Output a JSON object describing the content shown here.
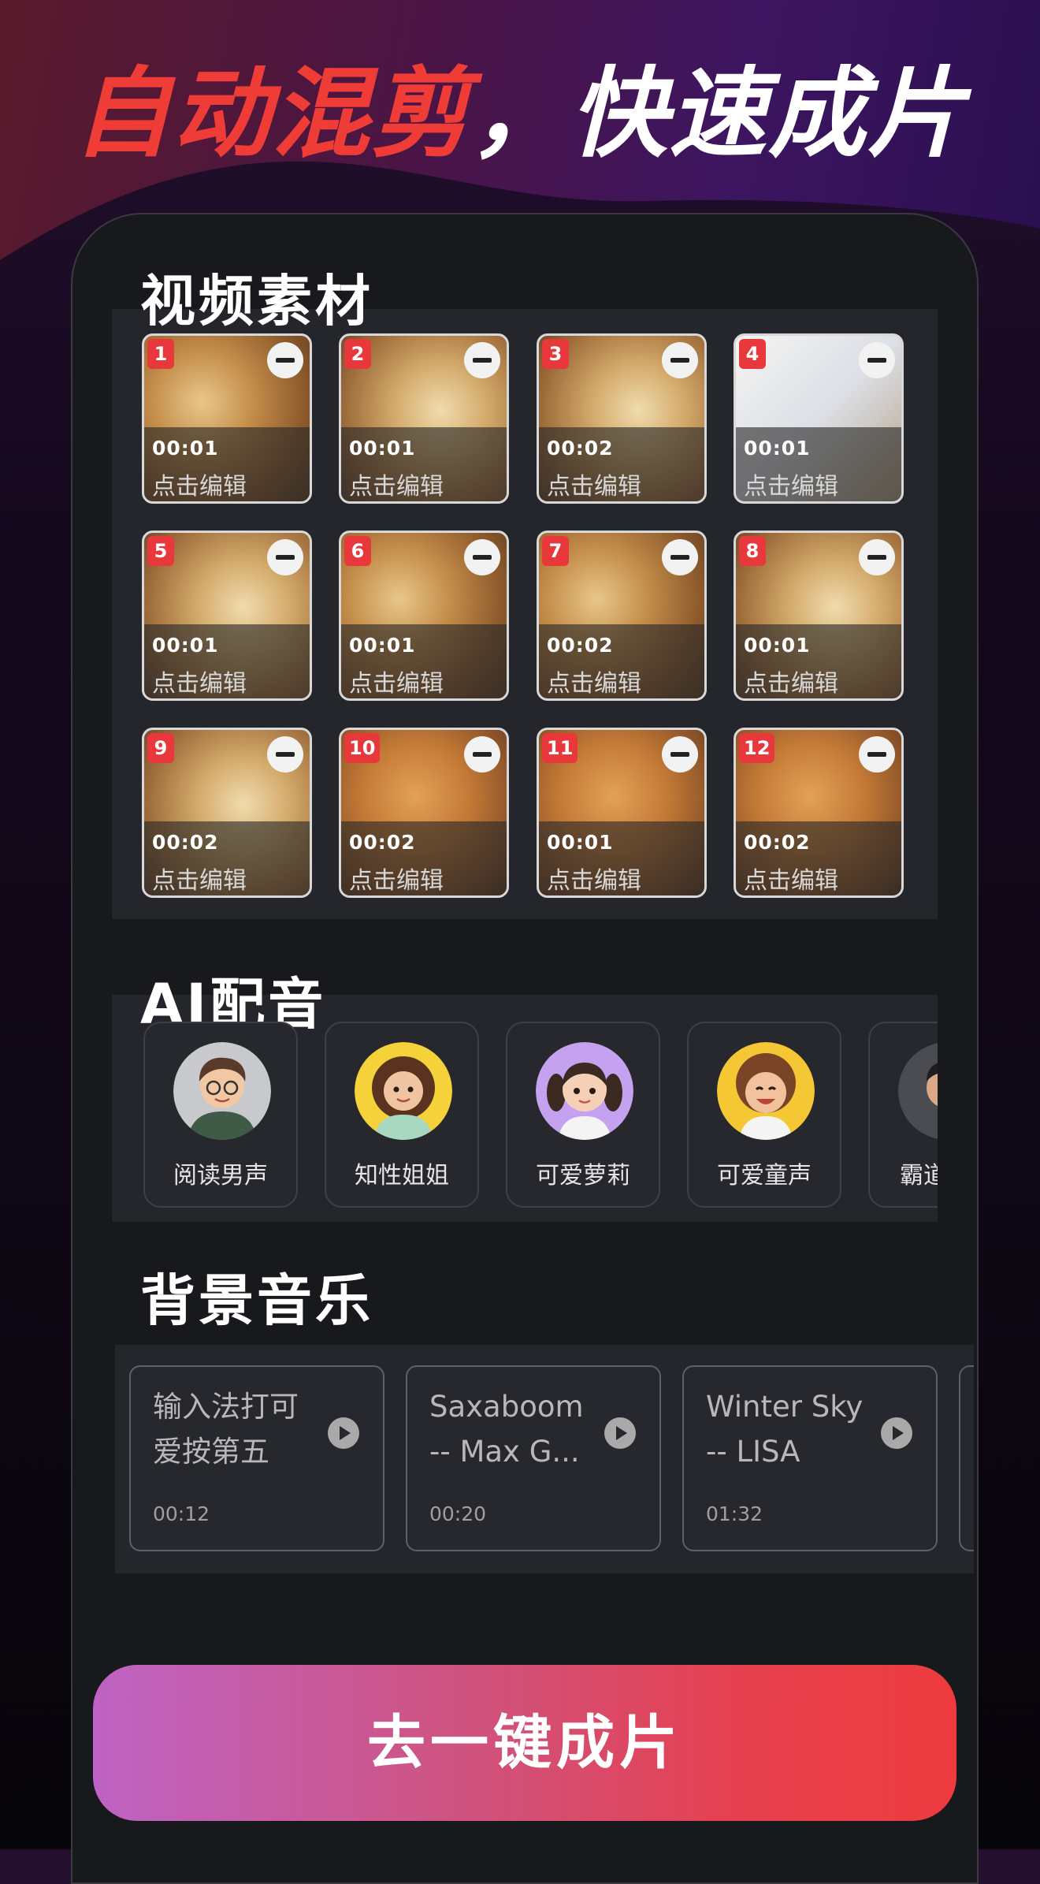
{
  "headline": {
    "highlight": "自动混剪",
    "rest": "，快速成片"
  },
  "sections": {
    "video": "视频素材",
    "voice": "AI配音",
    "music": "背景音乐"
  },
  "clips": [
    {
      "num": "1",
      "duration": "00:01",
      "action": "点击编辑"
    },
    {
      "num": "2",
      "duration": "00:01",
      "action": "点击编辑"
    },
    {
      "num": "3",
      "duration": "00:02",
      "action": "点击编辑"
    },
    {
      "num": "4",
      "duration": "00:01",
      "action": "点击编辑"
    },
    {
      "num": "5",
      "duration": "00:01",
      "action": "点击编辑"
    },
    {
      "num": "6",
      "duration": "00:01",
      "action": "点击编辑"
    },
    {
      "num": "7",
      "duration": "00:02",
      "action": "点击编辑"
    },
    {
      "num": "8",
      "duration": "00:01",
      "action": "点击编辑"
    },
    {
      "num": "9",
      "duration": "00:02",
      "action": "点击编辑"
    },
    {
      "num": "10",
      "duration": "00:02",
      "action": "点击编辑"
    },
    {
      "num": "11",
      "duration": "00:01",
      "action": "点击编辑"
    },
    {
      "num": "12",
      "duration": "00:02",
      "action": "点击编辑"
    }
  ],
  "voices": [
    {
      "name": "阅读男声",
      "icon": "avatar-glasses-man"
    },
    {
      "name": "知性姐姐",
      "icon": "avatar-curly-woman"
    },
    {
      "name": "可爱萝莉",
      "icon": "avatar-pigtail-girl"
    },
    {
      "name": "可爱童声",
      "icon": "avatar-curly-child"
    },
    {
      "name": "霸道",
      "icon": "avatar-man"
    }
  ],
  "music": [
    {
      "title": "输入法打可\n爱按第五",
      "duration": "00:12"
    },
    {
      "title": "Saxaboom\n-- Max G...",
      "duration": "00:20"
    },
    {
      "title": "Winter Sky\n-- LISA",
      "duration": "01:32"
    }
  ],
  "cta": "去一键成片",
  "colors": {
    "accent": "#f03c36",
    "badge": "#e8383c",
    "cta_start": "#be63c4",
    "cta_end": "#ee3b3f"
  }
}
